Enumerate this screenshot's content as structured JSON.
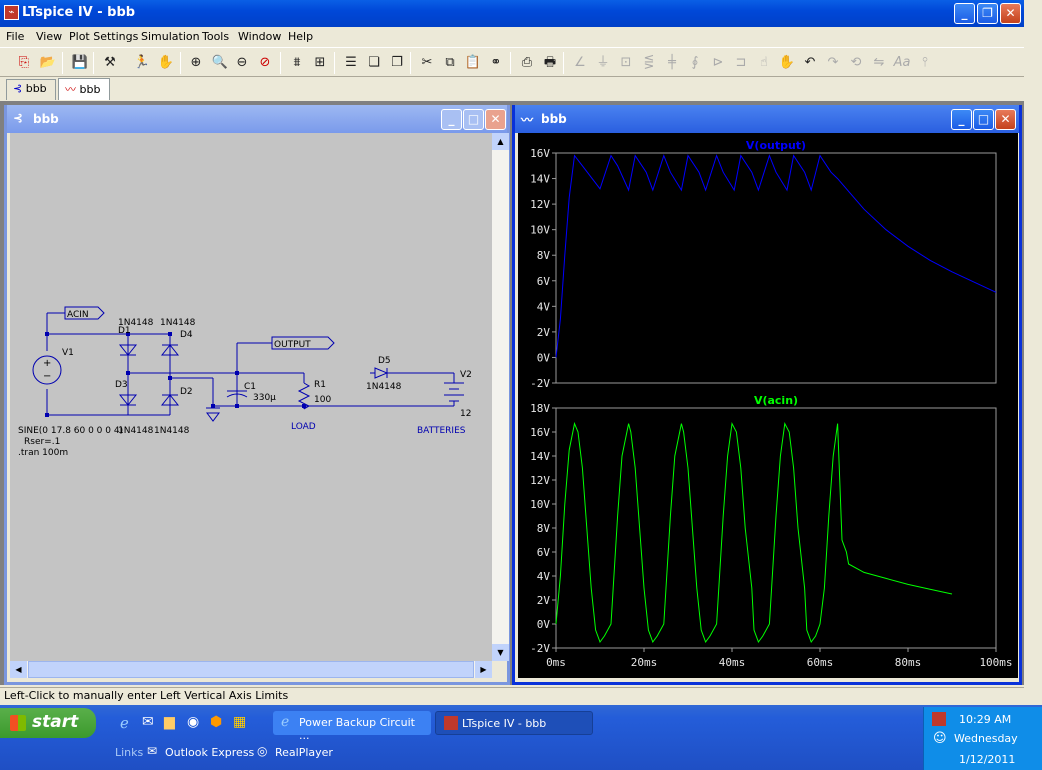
{
  "window": {
    "title": "LTspice IV - bbb"
  },
  "menu": [
    "File",
    "View",
    "Plot Settings",
    "Simulation",
    "Tools",
    "Window",
    "Help"
  ],
  "tabs": [
    {
      "label": "bbb"
    },
    {
      "label": "bbb"
    }
  ],
  "schematic": {
    "title": "bbb",
    "labels": {
      "acin": "ACIN",
      "output": "OUTPUT",
      "v1": "V1",
      "d1": "D1",
      "d1_part": "1N4148",
      "d4": "D4",
      "d4_part": "1N4148",
      "d3": "D3",
      "d3_part": "1N4148",
      "d2": "D2",
      "d2_part": "1N4148",
      "c1": "C1",
      "c1_val": "330µ",
      "r1": "R1",
      "r1_val": "100",
      "load": "LOAD",
      "d5": "D5",
      "d5_part": "1N4148",
      "v2": "V2",
      "v2_val": "12",
      "batteries": "BATTERIES",
      "src1": "SINE(0 17.8 60 0 0 0 4)",
      "src2": "Rser=.1",
      "tran": ".tran 100m"
    }
  },
  "plot": {
    "title": "bbb",
    "chart_data": [
      {
        "type": "line",
        "title": "V(output)",
        "color": "#0000ff",
        "ylim": [
          -2,
          16
        ],
        "xlim": [
          0,
          100
        ],
        "yticks": [
          "16V",
          "14V",
          "12V",
          "10V",
          "8V",
          "6V",
          "4V",
          "2V",
          "0V",
          "-2V"
        ],
        "x": [
          0,
          1,
          2,
          3,
          4.2,
          6,
          8,
          10,
          12.5,
          14,
          16.5,
          18,
          20.5,
          22,
          24.5,
          26,
          28.5,
          30,
          32.5,
          34,
          36.5,
          38,
          40.5,
          42,
          44.5,
          46,
          48.5,
          50,
          52.5,
          54,
          56.5,
          58,
          60,
          62.5,
          64,
          66,
          70,
          75,
          80,
          85,
          90,
          95,
          100
        ],
        "y": [
          0,
          3,
          8,
          12.5,
          15.8,
          15.0,
          14.1,
          13.2,
          15.8,
          15.0,
          13.1,
          15.8,
          14.5,
          13.1,
          15.8,
          14.5,
          13.1,
          15.8,
          14.5,
          13.1,
          15.8,
          14.5,
          13.1,
          15.8,
          14.5,
          13.1,
          15.8,
          14.5,
          13.1,
          15.8,
          14.5,
          13.1,
          15.8,
          14.5,
          14.0,
          13.2,
          11.6,
          10.0,
          8.7,
          7.6,
          6.7,
          5.9,
          5.1
        ]
      },
      {
        "type": "line",
        "title": "V(acin)",
        "color": "#00ff00",
        "ylim": [
          -2,
          18
        ],
        "xlim": [
          0,
          100
        ],
        "yticks": [
          "18V",
          "16V",
          "14V",
          "12V",
          "10V",
          "8V",
          "6V",
          "4V",
          "2V",
          "0V",
          "-2V"
        ],
        "xticks": [
          "0ms",
          "20ms",
          "40ms",
          "60ms",
          "80ms",
          "100ms"
        ],
        "x": [
          0,
          1,
          2,
          3,
          4.2,
          5,
          6,
          7,
          8,
          9,
          10,
          11,
          12.5,
          13,
          14,
          15,
          16.5,
          17,
          18,
          19,
          20,
          21,
          22,
          23,
          24.5,
          25,
          26,
          27,
          28.5,
          29,
          30,
          31,
          32,
          33,
          34,
          35,
          36.5,
          37,
          38,
          39,
          40,
          41,
          42,
          43,
          44.5,
          45,
          46,
          47,
          48.5,
          49,
          50,
          51,
          52,
          53,
          54,
          55,
          56.5,
          57,
          58,
          59,
          60,
          61,
          62,
          63,
          64,
          65,
          66,
          66.5,
          70,
          75,
          80,
          85,
          90,
          95,
          100
        ],
        "y": [
          0,
          4,
          10,
          14.5,
          16.7,
          16,
          13,
          8,
          3,
          -0.5,
          -1.5,
          -1,
          0,
          3,
          9,
          14,
          16.7,
          16,
          13,
          8,
          3,
          -0.5,
          -1.5,
          -1,
          0,
          3,
          9,
          14,
          16.7,
          16,
          13,
          8,
          3,
          -0.5,
          -1.5,
          -1,
          0,
          3,
          9,
          14,
          16.7,
          16,
          13,
          8,
          3,
          -0.5,
          -1.5,
          -1,
          0,
          3,
          9,
          14,
          16.7,
          16,
          13,
          8,
          3,
          -0.5,
          -1.5,
          -1,
          0,
          3,
          9,
          14,
          16.7,
          7.0,
          6.0,
          5.0,
          4.3,
          3.8,
          3.3,
          2.9,
          2.5
        ]
      }
    ]
  },
  "status": "Left-Click to manually enter Left Vertical Axis Limits",
  "taskbar": {
    "start": "start",
    "task1": "Power Backup Circuit ...",
    "task2": "LTspice IV - bbb",
    "ql1": "Links",
    "ql2": "Outlook Express",
    "ql3": "RealPlayer",
    "time": "10:29 AM",
    "day": "Wednesday",
    "date": "1/12/2011"
  }
}
